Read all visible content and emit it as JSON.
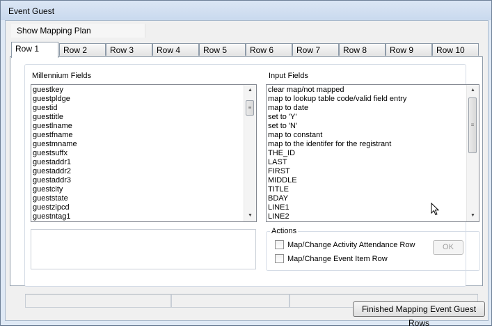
{
  "window": {
    "title": "Event Guest"
  },
  "menu": {
    "show_mapping_plan": "Show Mapping Plan"
  },
  "tabs": [
    "Row 1",
    "Row 2",
    "Row 3",
    "Row 4",
    "Row 5",
    "Row 6",
    "Row 7",
    "Row 8",
    "Row 9",
    "Row 10"
  ],
  "active_tab": "Row 1",
  "millennium_fields": {
    "label": "Millennium Fields",
    "items": [
      "guestkey",
      "guestpldge",
      "guestid",
      "guesttitle",
      "guestlname",
      "guestfname",
      "guestmname",
      "guestsuffx",
      "guestaddr1",
      "guestaddr2",
      "guestaddr3",
      "guestcity",
      "gueststate",
      "guestzipcd",
      "guestntag1"
    ]
  },
  "input_fields": {
    "label": "Input Fields",
    "items": [
      "clear map/not mapped",
      "map to lookup table code/valid field entry",
      "map to date",
      "set to 'Y'",
      "set to 'N'",
      "map to constant",
      "map to the identifer for the registrant",
      "THE_ID",
      "LAST",
      "FIRST",
      "MIDDLE",
      "TITLE",
      "BDAY",
      "LINE1",
      "LINE2"
    ]
  },
  "actions": {
    "title": "Actions",
    "activity_attendance_label": "Map/Change Activity Attendance Row",
    "event_item_label": "Map/Change Event Item Row",
    "activity_attendance_checked": false,
    "event_item_checked": false,
    "ok_label": "OK"
  },
  "footer": {
    "finished_label": "Finished Mapping Event Guest Rows"
  },
  "colors": {
    "title_bar": "#c9d9ee",
    "window_border": "#6d7f96",
    "panel_background": "#f0f0f0"
  }
}
